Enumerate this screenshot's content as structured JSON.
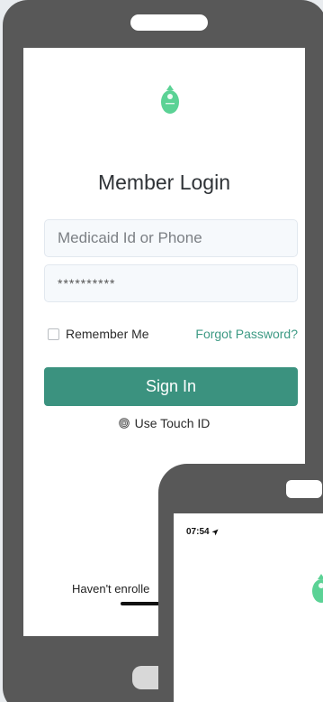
{
  "login_screen": {
    "title": "Member Login",
    "id_field": {
      "placeholder": "Medicaid Id or Phone",
      "value": ""
    },
    "password_field": {
      "value": "**********"
    },
    "remember_label": "Remember Me",
    "remember_checked": false,
    "forgot_label": "Forgot Password?",
    "signin_label": "Sign In",
    "touch_id_label": "Use Touch ID",
    "enroll_text": "Haven't enrolle"
  },
  "second_screen": {
    "status_time": "07:54"
  },
  "icons": {
    "logo": "leaf-drop-logo-icon",
    "fingerprint": "fingerprint-icon",
    "location": "location-arrow-icon"
  },
  "colors": {
    "brand_green": "#3b927f",
    "link_green": "#3d9a84",
    "logo_green": "#5bd295",
    "phone_frame": "#585858"
  }
}
